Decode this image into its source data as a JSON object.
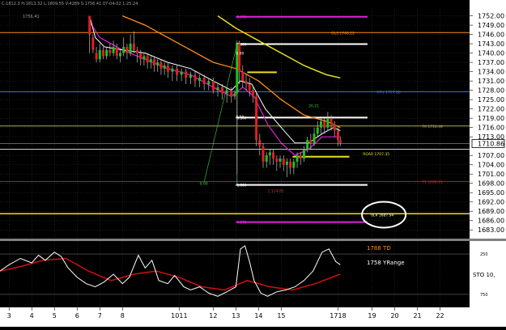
{
  "header": {
    "ohlc": "C:1812.3 H:1813.32 L:1809.55 V:4289 S:1756.41 07-04-02 1:25:24",
    "top_left_value": "1756.41"
  },
  "colors": {
    "background": "#000000",
    "grid": "#3a3a3a",
    "axis_text": "#000000",
    "axis_bg": "#ffffff",
    "candle_up": "#20c020",
    "candle_down": "#e02020",
    "wick": "#c0c0c0",
    "orange": "#ff8c1a",
    "yellow": "#e8e020",
    "magenta": "#e020e0",
    "white": "#ffffff",
    "blue": "#4a6adf",
    "red_line": "#c02020",
    "pink": "#ff66c8",
    "stoch_white": "#ffffff",
    "stoch_red": "#d01010"
  },
  "chart_data": [
    {
      "type": "candlestick",
      "title": "",
      "ylim": [
        1681.5,
        1754.5
      ],
      "y_ticks": [
        1752.0,
        1749.0,
        1746.0,
        1743.0,
        1740.0,
        1737.0,
        1734.0,
        1731.0,
        1728.0,
        1725.0,
        1722.0,
        1719.0,
        1716.0,
        1713.0,
        1707.0,
        1704.0,
        1701.0,
        1698.0,
        1695.0,
        1692.0,
        1689.0,
        1686.0,
        1683.0
      ],
      "current_price": "1710.86",
      "x_ticks": [
        "3",
        "4",
        "5",
        "6",
        "7",
        "8",
        "1011",
        "12",
        "13",
        "14",
        "15",
        "1718",
        "19",
        "20",
        "21",
        "22"
      ],
      "x_tick_pos": [
        3,
        4,
        5,
        6,
        7,
        8,
        10.5,
        12,
        13,
        14,
        15,
        17.5,
        19,
        20,
        21,
        22
      ],
      "xlim": [
        2.6,
        23.3
      ],
      "candles": [
        [
          6.55,
          1752,
          1746,
          1752,
          1740
        ],
        [
          6.7,
          1745,
          1741,
          1746,
          1740
        ],
        [
          6.85,
          1740,
          1738,
          1742,
          1737
        ],
        [
          7.0,
          1738,
          1741,
          1743,
          1737
        ],
        [
          7.15,
          1741,
          1739,
          1742,
          1738
        ],
        [
          7.3,
          1739,
          1741,
          1742,
          1738
        ],
        [
          7.45,
          1741,
          1740,
          1743,
          1739
        ],
        [
          7.6,
          1740,
          1742,
          1744,
          1739
        ],
        [
          7.75,
          1742,
          1739,
          1743,
          1738
        ],
        [
          7.9,
          1739,
          1740,
          1741,
          1737
        ],
        [
          8.05,
          1740,
          1742,
          1745,
          1739
        ],
        [
          8.2,
          1742,
          1740,
          1743,
          1738
        ],
        [
          8.35,
          1740,
          1743,
          1746,
          1739
        ],
        [
          8.5,
          1743,
          1741,
          1747,
          1740
        ],
        [
          8.65,
          1741,
          1740,
          1742,
          1737
        ],
        [
          8.8,
          1740,
          1738,
          1741,
          1736
        ],
        [
          8.95,
          1738,
          1739,
          1740,
          1736
        ],
        [
          9.1,
          1739,
          1737,
          1740,
          1735
        ],
        [
          9.25,
          1737,
          1738,
          1739,
          1735
        ],
        [
          9.4,
          1738,
          1736,
          1739,
          1734
        ],
        [
          9.55,
          1736,
          1737,
          1738,
          1734
        ],
        [
          9.7,
          1737,
          1735,
          1738,
          1733
        ],
        [
          9.85,
          1735,
          1736,
          1737,
          1733
        ],
        [
          10.0,
          1736,
          1734,
          1737,
          1732
        ],
        [
          10.2,
          1734,
          1735,
          1736,
          1731
        ],
        [
          10.4,
          1735,
          1733,
          1736,
          1731
        ],
        [
          10.6,
          1733,
          1734,
          1735,
          1731
        ],
        [
          10.8,
          1734,
          1732,
          1735,
          1730
        ],
        [
          11.0,
          1732,
          1733,
          1734,
          1730
        ],
        [
          11.2,
          1733,
          1731,
          1734,
          1729
        ],
        [
          11.4,
          1731,
          1732,
          1733,
          1729
        ],
        [
          11.6,
          1732,
          1730,
          1733,
          1728
        ],
        [
          11.8,
          1730,
          1731,
          1732,
          1728
        ],
        [
          12.0,
          1731,
          1728,
          1732,
          1727
        ],
        [
          12.2,
          1728,
          1729,
          1730,
          1726
        ],
        [
          12.4,
          1729,
          1727,
          1730,
          1725
        ],
        [
          12.6,
          1727,
          1728,
          1729,
          1724
        ],
        [
          12.8,
          1728,
          1726,
          1729,
          1724
        ],
        [
          12.95,
          1726,
          1727,
          1728,
          1725
        ],
        [
          13.05,
          1727,
          1743,
          1744,
          1701
        ],
        [
          13.15,
          1743,
          1734,
          1744,
          1730
        ],
        [
          13.3,
          1734,
          1731,
          1736,
          1729
        ],
        [
          13.45,
          1731,
          1730,
          1733,
          1728
        ],
        [
          13.6,
          1730,
          1728,
          1732,
          1726
        ],
        [
          13.75,
          1728,
          1726,
          1729,
          1724
        ],
        [
          13.9,
          1726,
          1712,
          1727,
          1710
        ],
        [
          14.05,
          1712,
          1710,
          1714,
          1707
        ],
        [
          14.2,
          1710,
          1705,
          1711,
          1703
        ],
        [
          14.35,
          1705,
          1707,
          1708,
          1703
        ],
        [
          14.5,
          1707,
          1708,
          1709,
          1704
        ],
        [
          14.65,
          1708,
          1706,
          1709,
          1704
        ],
        [
          14.8,
          1706,
          1705,
          1707,
          1702
        ],
        [
          14.95,
          1705,
          1706,
          1707,
          1703
        ],
        [
          15.1,
          1706,
          1704,
          1707,
          1702
        ],
        [
          15.25,
          1704,
          1705,
          1706,
          1700
        ],
        [
          15.4,
          1705,
          1703,
          1706,
          1701
        ],
        [
          15.55,
          1703,
          1705,
          1706,
          1701
        ],
        [
          15.7,
          1705,
          1707,
          1708,
          1703
        ],
        [
          15.85,
          1707,
          1706,
          1708,
          1704
        ],
        [
          16.0,
          1706,
          1709,
          1710,
          1705
        ],
        [
          16.15,
          1709,
          1712,
          1713,
          1708
        ],
        [
          16.3,
          1712,
          1711,
          1714,
          1709
        ],
        [
          16.45,
          1711,
          1714,
          1716,
          1710
        ],
        [
          16.6,
          1714,
          1716,
          1718,
          1713
        ],
        [
          16.75,
          1716,
          1718,
          1719,
          1714
        ],
        [
          16.9,
          1718,
          1716,
          1719,
          1714
        ],
        [
          17.05,
          1716,
          1719,
          1721,
          1715
        ],
        [
          17.2,
          1719,
          1717,
          1720,
          1715
        ],
        [
          17.35,
          1717,
          1715,
          1718,
          1713
        ],
        [
          17.5,
          1715,
          1712,
          1716,
          1710
        ],
        [
          17.6,
          1712,
          1711,
          1713,
          1710
        ]
      ],
      "ma_white": [
        [
          6.55,
          1752
        ],
        [
          6.8,
          1745
        ],
        [
          7.2,
          1742
        ],
        [
          8,
          1741
        ],
        [
          9,
          1740
        ],
        [
          10,
          1737
        ],
        [
          11,
          1735
        ],
        [
          12,
          1731
        ],
        [
          12.8,
          1728
        ],
        [
          13.2,
          1731
        ],
        [
          13.7,
          1730
        ],
        [
          14.3,
          1722
        ],
        [
          15,
          1716
        ],
        [
          15.6,
          1711
        ],
        [
          16.2,
          1711
        ],
        [
          16.8,
          1714
        ],
        [
          17.3,
          1716
        ],
        [
          17.6,
          1715
        ]
      ],
      "ma_magenta": [
        [
          6.55,
          1750
        ],
        [
          7,
          1745
        ],
        [
          8,
          1741
        ],
        [
          9,
          1738
        ],
        [
          10,
          1735
        ],
        [
          11,
          1733
        ],
        [
          12,
          1729
        ],
        [
          12.8,
          1726
        ],
        [
          13.3,
          1729
        ],
        [
          13.8,
          1726
        ],
        [
          14.4,
          1717
        ],
        [
          15,
          1711
        ],
        [
          15.6,
          1707
        ],
        [
          16.2,
          1709
        ],
        [
          16.8,
          1713
        ],
        [
          17.6,
          1713
        ]
      ],
      "ma_orange": [
        [
          8,
          1752
        ],
        [
          9,
          1749
        ],
        [
          10,
          1745
        ],
        [
          11,
          1741
        ],
        [
          12,
          1737
        ],
        [
          13,
          1735
        ],
        [
          14,
          1731
        ],
        [
          15,
          1725
        ],
        [
          16,
          1720
        ],
        [
          17,
          1718
        ],
        [
          17.6,
          1716
        ]
      ],
      "ma_yellow": [
        [
          12.2,
          1752
        ],
        [
          13,
          1748
        ],
        [
          14,
          1744
        ],
        [
          15,
          1740
        ],
        [
          16,
          1736
        ],
        [
          17,
          1733
        ],
        [
          17.6,
          1732
        ]
      ],
      "levels": [
        {
          "y": 1746.6,
          "x1": 2.6,
          "x2": 23.3,
          "color": "orange",
          "label": "OL3 1746.12",
          "lx": 17.2
        },
        {
          "y": 1727.5,
          "x1": 2.6,
          "x2": 23.3,
          "color": "blue",
          "label": "OR1 1727.88",
          "lx": 19.2
        },
        {
          "y": 1716.5,
          "x1": 2.6,
          "x2": 23.3,
          "color": "yellow_dim",
          "label": "70 1716.49",
          "lx": 21.2
        },
        {
          "y": 1698.6,
          "x1": 2.6,
          "x2": 23.3,
          "color": "red_line",
          "label": "71 1698.91",
          "lx": 21.2
        },
        {
          "y": 1688.2,
          "x1": 2.6,
          "x2": 23.3,
          "color": "yellow",
          "label": "",
          "lx": 0
        },
        {
          "y": 1709.0,
          "x1": 2.6,
          "x2": 23.3,
          "color": "white_thin",
          "label": "",
          "lx": 0
        }
      ],
      "fib_lines": [
        {
          "y": 1751.7,
          "x1": 13.0,
          "x2": 18.8,
          "color": "magenta",
          "label": "1.272",
          "lx": 13.05
        },
        {
          "y": 1742.9,
          "x1": 13.0,
          "x2": 18.8,
          "color": "white",
          "label": "0.000",
          "lx": 13.05
        },
        {
          "y": 1733.8,
          "x1": 13.5,
          "x2": 14.8,
          "color": "yellow",
          "label": "",
          "lx": 0
        },
        {
          "y": 1719.2,
          "x1": 13.0,
          "x2": 18.8,
          "color": "white",
          "label": "0.500",
          "lx": 13.05
        },
        {
          "y": 1706.6,
          "x1": 15.5,
          "x2": 18.0,
          "color": "yellow",
          "label": "",
          "lx": 0
        },
        {
          "y": 1697.5,
          "x1": 13.0,
          "x2": 18.8,
          "color": "white",
          "label": "1.000",
          "lx": 13.05
        },
        {
          "y": 1685.5,
          "x1": 13.0,
          "x2": 18.8,
          "color": "magenta",
          "label": "1.272",
          "lx": 13.05
        }
      ],
      "labels": [
        {
          "text": "ROAR 1707.35",
          "x": 18.6,
          "y": 1707.0,
          "color": "yellow"
        },
        {
          "text": "20-21",
          "x": 16.2,
          "y": 1722.5,
          "color": "green"
        },
        {
          "text": "1.114 85",
          "x": 14.4,
          "y": 1695.2,
          "color": "red"
        },
        {
          "text": "0.00",
          "x": 11.4,
          "y": 1697.5,
          "color": "green"
        },
        {
          "text": "0.00",
          "x": 13.0,
          "y": 1739.5,
          "color": "white"
        },
        {
          "text": "0.50",
          "x": 13.0,
          "y": 1719.0,
          "color": "white"
        }
      ],
      "annotation": {
        "text": "0L4 1687.94",
        "x": 18.95,
        "y": 1687.9,
        "circle": true
      }
    },
    {
      "type": "line",
      "title": "STO",
      "indicator_label": "STO 10,",
      "legend": [
        {
          "text": "1788 TD",
          "color": "orange"
        },
        {
          "text": "1758 YRange",
          "color": "white"
        }
      ],
      "right_ticks": [
        "250",
        "750"
      ],
      "right_tick_values": [
        82,
        18
      ],
      "ylim": [
        0,
        100
      ],
      "white": [
        [
          2.6,
          55
        ],
        [
          3,
          65
        ],
        [
          3.5,
          75
        ],
        [
          4,
          68
        ],
        [
          4.3,
          80
        ],
        [
          4.6,
          72
        ],
        [
          5,
          85
        ],
        [
          5.3,
          78
        ],
        [
          5.6,
          60
        ],
        [
          6,
          45
        ],
        [
          6.4,
          35
        ],
        [
          6.8,
          30
        ],
        [
          7.2,
          38
        ],
        [
          7.6,
          50
        ],
        [
          8,
          35
        ],
        [
          8.3,
          45
        ],
        [
          8.7,
          80
        ],
        [
          9,
          60
        ],
        [
          9.3,
          72
        ],
        [
          9.6,
          40
        ],
        [
          10,
          35
        ],
        [
          10.3,
          48
        ],
        [
          10.7,
          30
        ],
        [
          11,
          25
        ],
        [
          11.4,
          30
        ],
        [
          11.8,
          20
        ],
        [
          12.2,
          15
        ],
        [
          12.6,
          22
        ],
        [
          13,
          30
        ],
        [
          13.2,
          90
        ],
        [
          13.4,
          95
        ],
        [
          13.6,
          70
        ],
        [
          13.8,
          40
        ],
        [
          14.1,
          20
        ],
        [
          14.4,
          15
        ],
        [
          14.8,
          22
        ],
        [
          15.2,
          25
        ],
        [
          15.6,
          30
        ],
        [
          16,
          40
        ],
        [
          16.4,
          55
        ],
        [
          16.8,
          85
        ],
        [
          17.1,
          90
        ],
        [
          17.4,
          70
        ],
        [
          17.6,
          65
        ]
      ],
      "red": [
        [
          2.6,
          55
        ],
        [
          3.5,
          62
        ],
        [
          4.5,
          72
        ],
        [
          5.5,
          75
        ],
        [
          6.5,
          55
        ],
        [
          7.5,
          40
        ],
        [
          8.5,
          50
        ],
        [
          9.5,
          55
        ],
        [
          10.5,
          45
        ],
        [
          11.5,
          30
        ],
        [
          12.5,
          25
        ],
        [
          13.5,
          40
        ],
        [
          14.5,
          30
        ],
        [
          15.5,
          25
        ],
        [
          16.5,
          35
        ],
        [
          17.6,
          50
        ]
      ]
    }
  ]
}
